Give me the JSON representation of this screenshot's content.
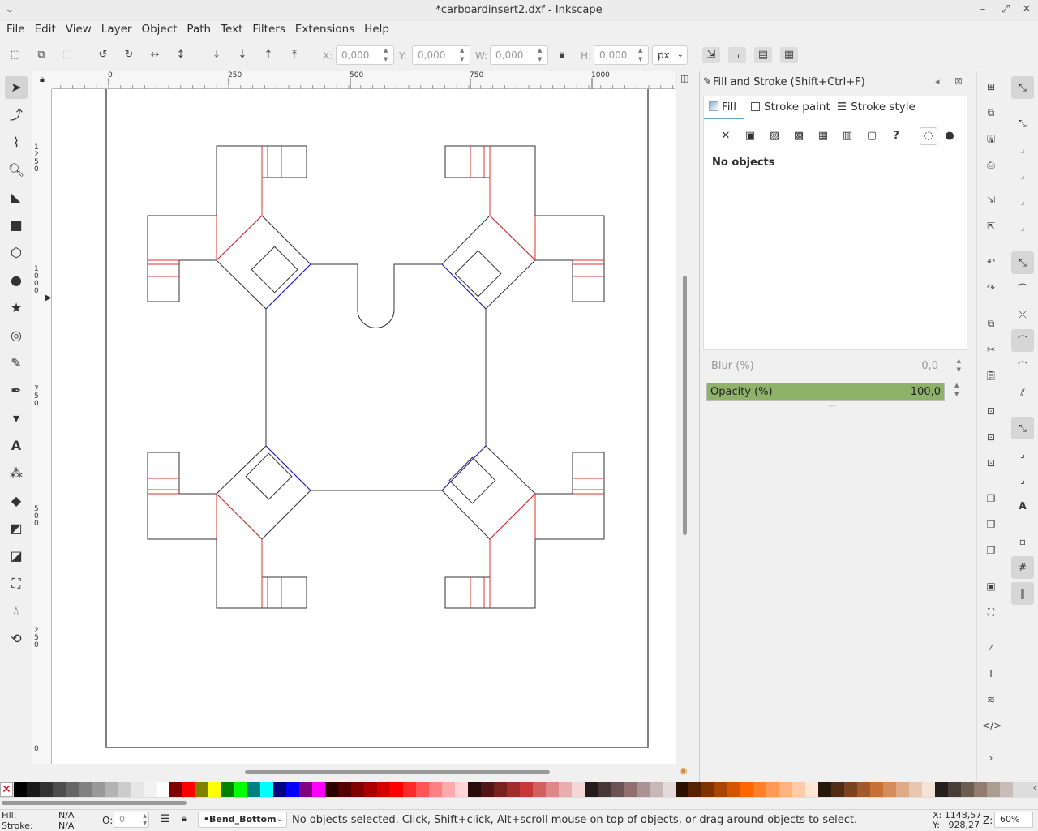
{
  "window": {
    "title": "*carboardinsert2.dxf - Inkscape"
  },
  "menu": [
    "File",
    "Edit",
    "View",
    "Layer",
    "Object",
    "Path",
    "Text",
    "Filters",
    "Extensions",
    "Help"
  ],
  "toolbar": {
    "x_label": "X:",
    "x_value": "0,000",
    "y_label": "Y:",
    "y_value": "0,000",
    "w_label": "W:",
    "w_value": "0,000",
    "h_label": "H:",
    "h_value": "0,000",
    "unit": "px"
  },
  "ruler": {
    "top_ticks": [
      "0",
      "250",
      "500",
      "750",
      "1000"
    ],
    "left_ticks": [
      "1 2 5 0",
      "1 0 0 0",
      "7 5 0",
      "5 0 0",
      "2 5 0",
      "0"
    ]
  },
  "dock": {
    "title": "Fill and Stroke (Shift+Ctrl+F)",
    "tabs": [
      "Fill",
      "Stroke paint",
      "Stroke style"
    ],
    "message": "No objects",
    "blur_label": "Blur (%)",
    "blur_value": "0,0",
    "opacity_label": "Opacity (%)",
    "opacity_value": "100,0",
    "opacity_level": 1.0
  },
  "status": {
    "fill_label": "Fill:",
    "fill_value": "N/A",
    "stroke_label": "Stroke:",
    "stroke_value": "N/A",
    "o_label": "O:",
    "o_value": "0",
    "layer": "•Bend_Bottom",
    "message": "No objects selected. Click, Shift+click, Alt+scroll mouse on top of objects, or drag around objects to select.",
    "x_coord": "X: 1148,57",
    "y_coord": "Y:   928,27",
    "zoom_label": "Z:",
    "zoom_value": "60%"
  },
  "colors": {
    "accent_opacity": "#8fb26a",
    "cut_line": "#222222",
    "fold_red": "#e03030",
    "fold_blue": "#2020d0"
  },
  "palette": [
    "#000000",
    "#1a1a1a",
    "#333333",
    "#4d4d4d",
    "#666666",
    "#808080",
    "#999999",
    "#b3b3b3",
    "#cccccc",
    "#e6e6e6",
    "#f2f2f2",
    "#ffffff",
    "#800000",
    "#ff0000",
    "#808000",
    "#ffff00",
    "#008000",
    "#00ff00",
    "#008080",
    "#00ffff",
    "#000080",
    "#0000ff",
    "#800080",
    "#ff00ff",
    "#2b0000",
    "#550000",
    "#800000",
    "#aa0000",
    "#d40000",
    "#ff0000",
    "#ff2a2a",
    "#ff5555",
    "#ff8080",
    "#ffaaaa",
    "#ffd5d5",
    "#280b0b",
    "#501616",
    "#782121",
    "#a02c2c",
    "#c83737",
    "#d35f5f",
    "#de8787",
    "#e9afaf",
    "#f4d7d7",
    "#241c1c",
    "#483737",
    "#6c5353",
    "#916f6f",
    "#ac9393",
    "#c8b7b7",
    "#e3dbdb",
    "#2b1100",
    "#552200",
    "#803300",
    "#aa4400",
    "#d45500",
    "#ff6600",
    "#ff7f2a",
    "#ff9955",
    "#ffb380",
    "#ffccaa",
    "#ffe6d5",
    "#28170b",
    "#502d16",
    "#784421",
    "#a05a2c",
    "#c87137",
    "#d38d5f",
    "#deaa87",
    "#e9c6af",
    "#f4e3d7",
    "#241f1c",
    "#483e37",
    "#6c5d53",
    "#917c6f",
    "#ac9d93",
    "#c8beb7"
  ]
}
